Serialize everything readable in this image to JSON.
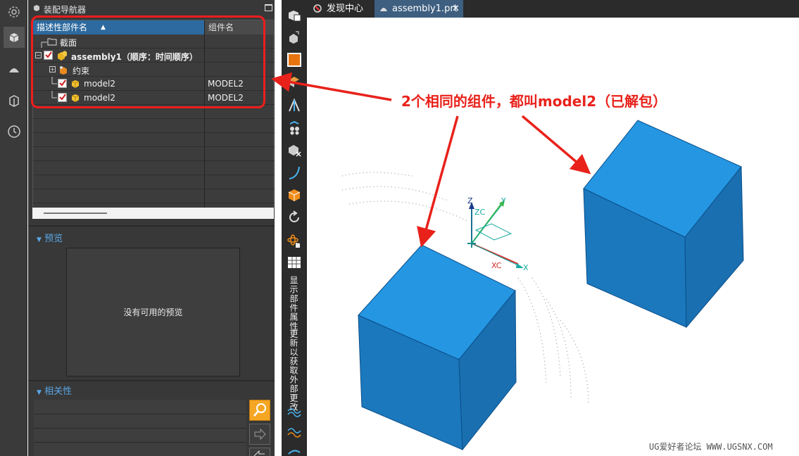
{
  "left_iconbar": {
    "icons": [
      "settings-icon",
      "assembly-navigator-icon",
      "part-navigator-icon",
      "reuse-library-icon",
      "history-clock-icon"
    ]
  },
  "navigator": {
    "title": "装配导航器",
    "columns": [
      "描述性部件名",
      "组件名"
    ],
    "rows": [
      {
        "label": "截面",
        "component": ""
      },
      {
        "label": "assembly1（顺序：时间顺序）",
        "component": ""
      },
      {
        "label": "约束",
        "component": ""
      },
      {
        "label": "model2",
        "component": "MODEL2"
      },
      {
        "label": "model2",
        "component": "MODEL2"
      }
    ]
  },
  "preview": {
    "title": "预览",
    "empty_text": "没有可用的预览"
  },
  "dependencies": {
    "title": "相关性"
  },
  "toolbar": {
    "vertical_label_1": "显示部件属性",
    "vertical_label_2": "更新以获取外部更改"
  },
  "tabs": [
    {
      "label": "发现中心",
      "active": false
    },
    {
      "label": "assembly1.prt",
      "active": true
    }
  ],
  "viewport": {
    "annotation": "2个相同的组件，都叫model2（已解包）",
    "triad": {
      "z": "Z",
      "zc": "ZC",
      "y": "Y",
      "xc": "XC",
      "x": "X"
    },
    "cube_color": "#1e8fd8",
    "annotation_color": "#e8221b"
  },
  "watermark": "UG爱好者论坛 WWW.UGSNX.COM"
}
